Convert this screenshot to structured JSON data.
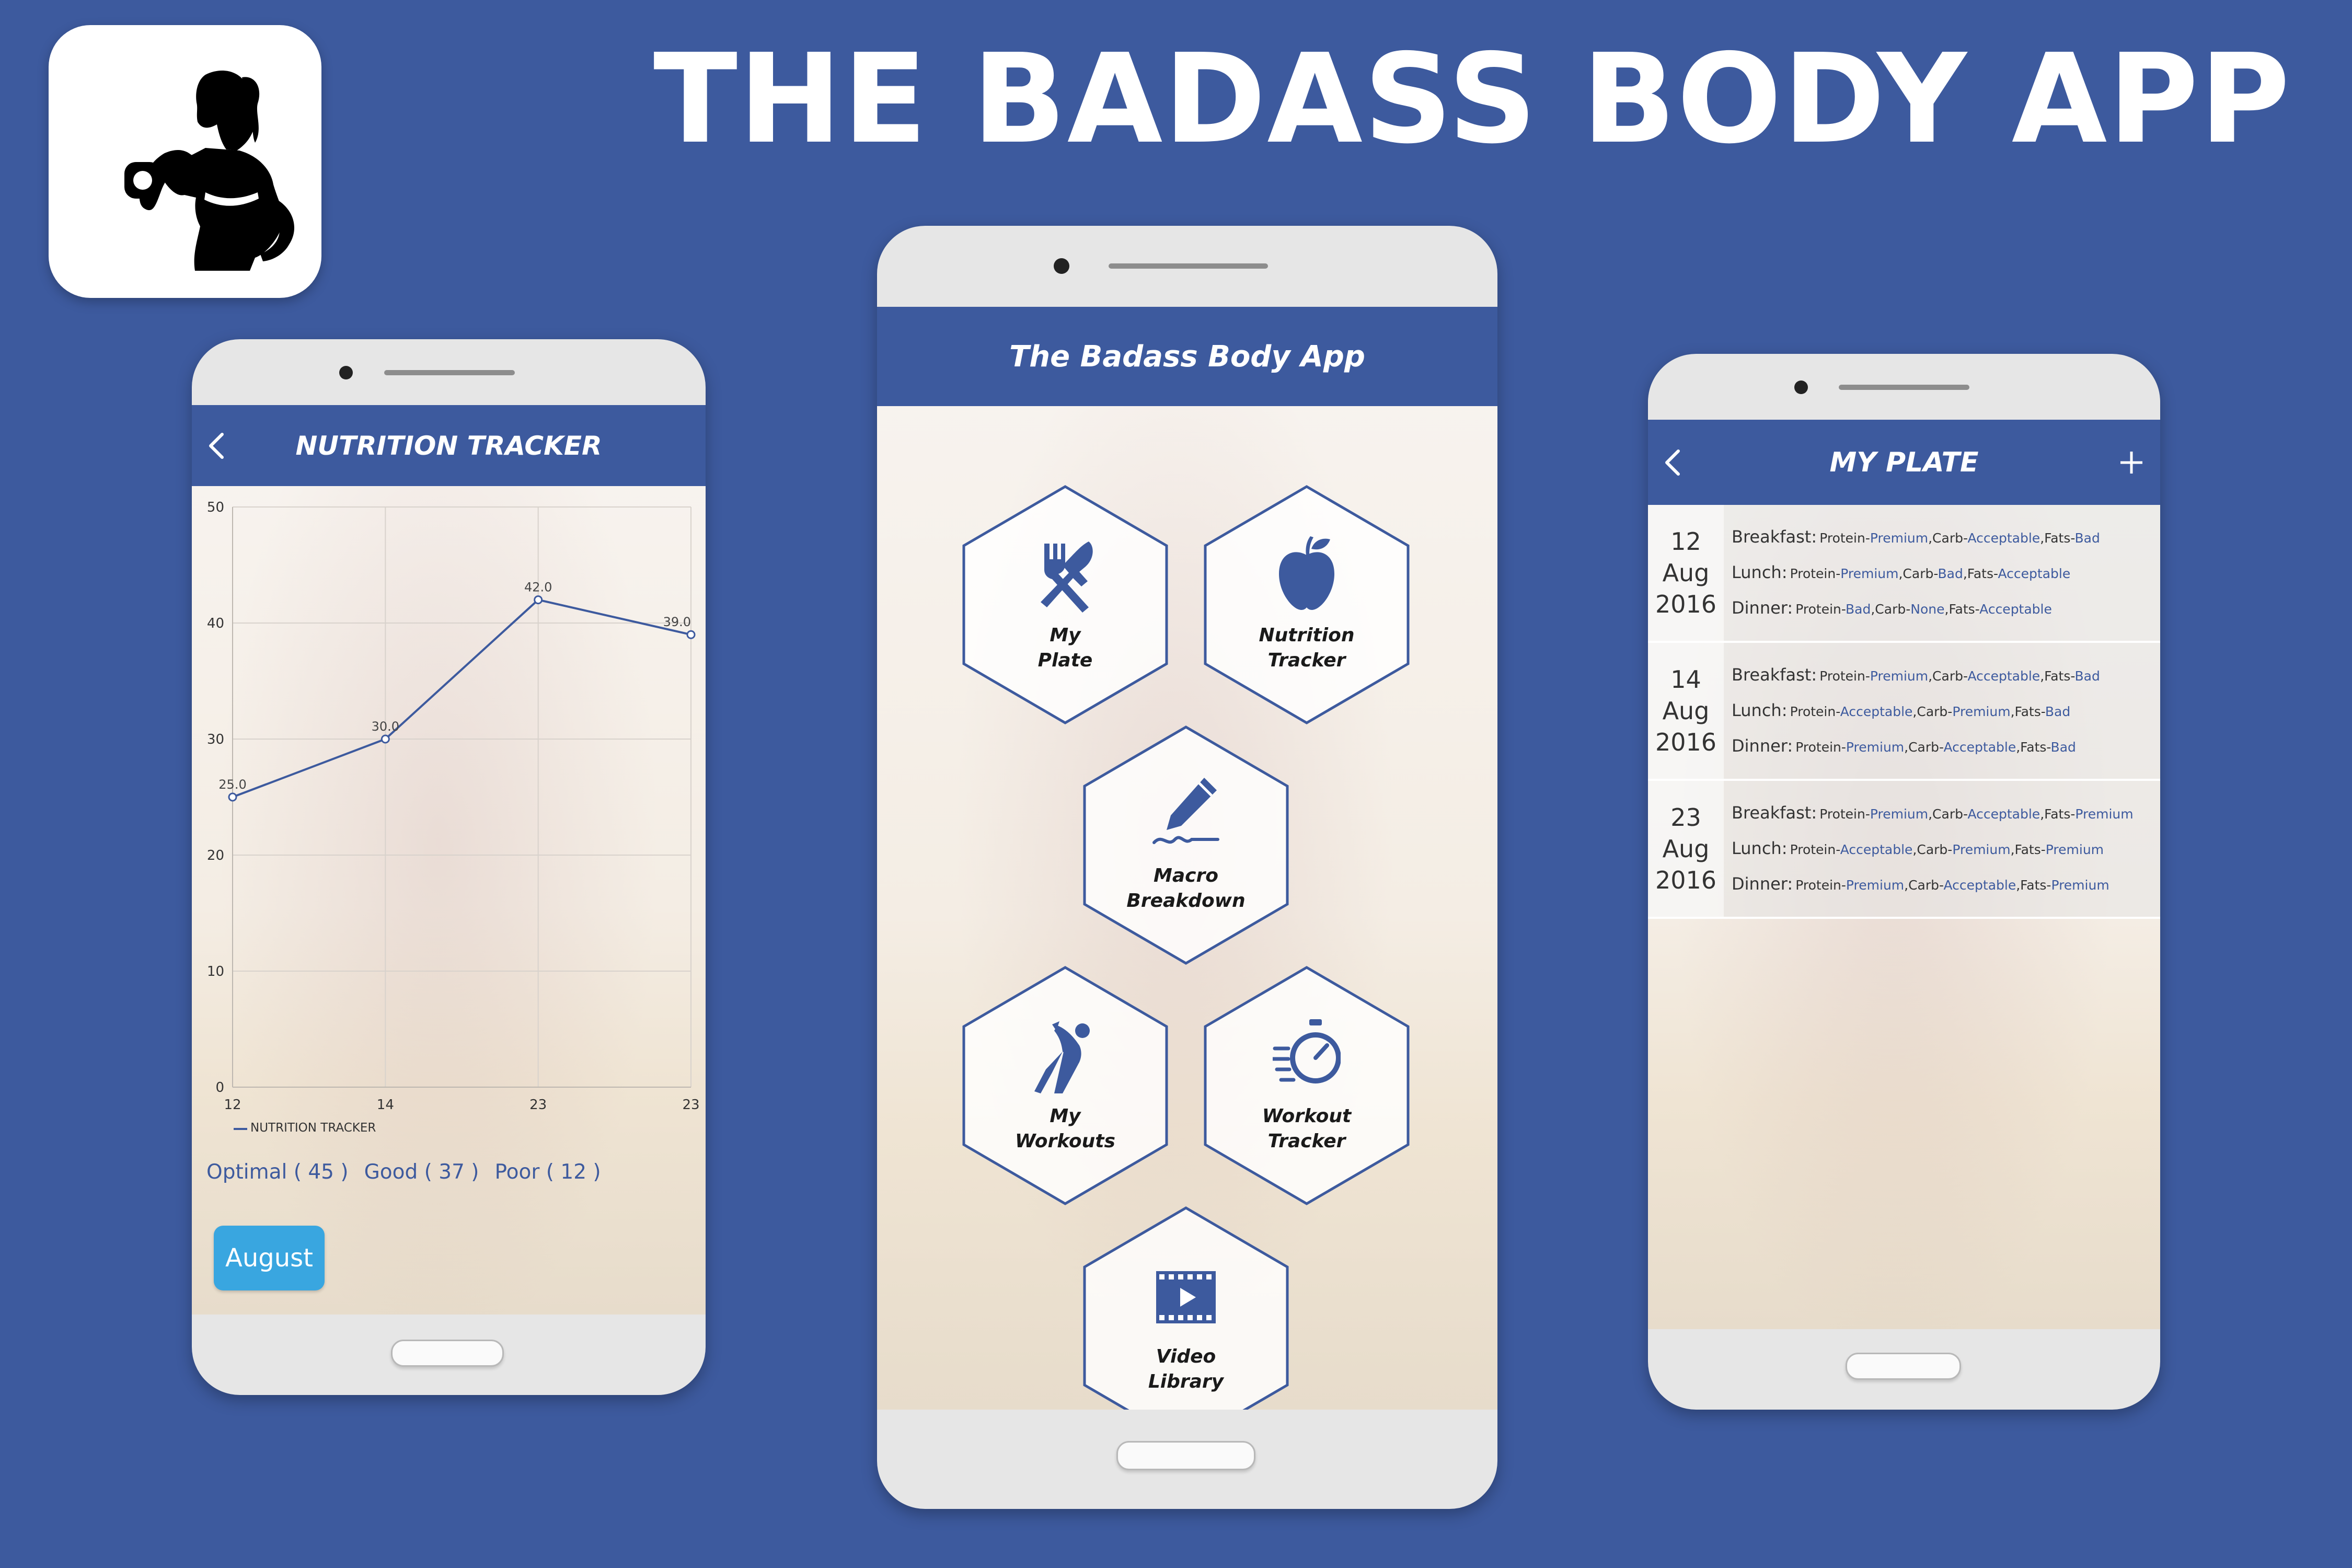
{
  "heading": {
    "title": "THE BADASS BODY APP"
  },
  "colors": {
    "brand_blue": "#3d5a9e",
    "button_blue": "#39a6e0",
    "white": "#ffffff"
  },
  "icons": {
    "app_logo": "woman-dumbbell-silhouette-icon",
    "back": "chevron-left-icon",
    "add": "plus-icon"
  },
  "nutrition_tracker": {
    "title": "NUTRITION TRACKER",
    "summary": {
      "optimal": "Optimal ( 45 )",
      "good": "Good ( 37 )",
      "poor": "Poor ( 12 )"
    },
    "month_button": "August",
    "chart_data": {
      "type": "line",
      "x": [
        "12",
        "14",
        "23",
        "23"
      ],
      "series": [
        {
          "name": "NUTRITION TRACKER",
          "values": [
            25.0,
            30.0,
            42.0,
            39.0
          ],
          "labels": [
            "25.0",
            "30.0",
            "42.0",
            "39.0"
          ]
        }
      ],
      "ylim": [
        0,
        50
      ],
      "yticks": [
        "0",
        "10",
        "20",
        "30",
        "40",
        "50"
      ],
      "grid": true,
      "legend": "bottom-left",
      "color": "#3d5a9e"
    }
  },
  "home": {
    "title": "The Badass Body App",
    "tiles": [
      {
        "label": "My\nPlate",
        "icon": "fork-knife-icon"
      },
      {
        "label": "Nutrition\nTracker",
        "icon": "apple-icon"
      },
      {
        "label": "Macro\nBreakdown",
        "icon": "pen-signature-icon"
      },
      {
        "label": "My\nWorkouts",
        "icon": "stretching-person-icon"
      },
      {
        "label": "Workout\nTracker",
        "icon": "stopwatch-icon"
      },
      {
        "label": "Video\nLibrary",
        "icon": "film-play-icon"
      }
    ]
  },
  "my_plate": {
    "title": "MY PLATE",
    "entries": [
      {
        "day": "12",
        "month": "Aug",
        "year": "2016",
        "meals": [
          {
            "label": "Breakfast:",
            "parts": [
              "Protein-",
              "Premium",
              ",Carb-",
              "Acceptable",
              ",Fats-",
              "Bad"
            ]
          },
          {
            "label": "Lunch:",
            "parts": [
              "Protein-",
              "Premium",
              ",Carb-",
              "Bad",
              ",Fats-",
              "Acceptable"
            ]
          },
          {
            "label": "Dinner:",
            "parts": [
              "Protein-",
              "Bad",
              ",Carb-",
              "None",
              ",Fats-",
              "Acceptable"
            ]
          }
        ]
      },
      {
        "day": "14",
        "month": "Aug",
        "year": "2016",
        "meals": [
          {
            "label": "Breakfast:",
            "parts": [
              "Protein-",
              "Premium",
              ",Carb-",
              "Acceptable",
              ",Fats-",
              "Bad"
            ]
          },
          {
            "label": "Lunch:",
            "parts": [
              "Protein-",
              "Acceptable",
              ",Carb-",
              "Premium",
              ",Fats-",
              "Bad"
            ]
          },
          {
            "label": "Dinner:",
            "parts": [
              "Protein-",
              "Premium",
              ",Carb-",
              "Acceptable",
              ",Fats-",
              "Bad"
            ]
          }
        ]
      },
      {
        "day": "23",
        "month": "Aug",
        "year": "2016",
        "meals": [
          {
            "label": "Breakfast:",
            "parts": [
              "Protein-",
              "Premium",
              ",Carb-",
              "Acceptable",
              ",Fats-",
              "Premium"
            ]
          },
          {
            "label": "Lunch:",
            "parts": [
              "Protein-",
              "Acceptable",
              ",Carb-",
              "Premium",
              ",Fats-",
              "Premium"
            ]
          },
          {
            "label": "Dinner:",
            "parts": [
              "Protein-",
              "Premium",
              ",Carb-",
              "Acceptable",
              ",Fats-",
              "Premium"
            ]
          }
        ]
      }
    ]
  }
}
